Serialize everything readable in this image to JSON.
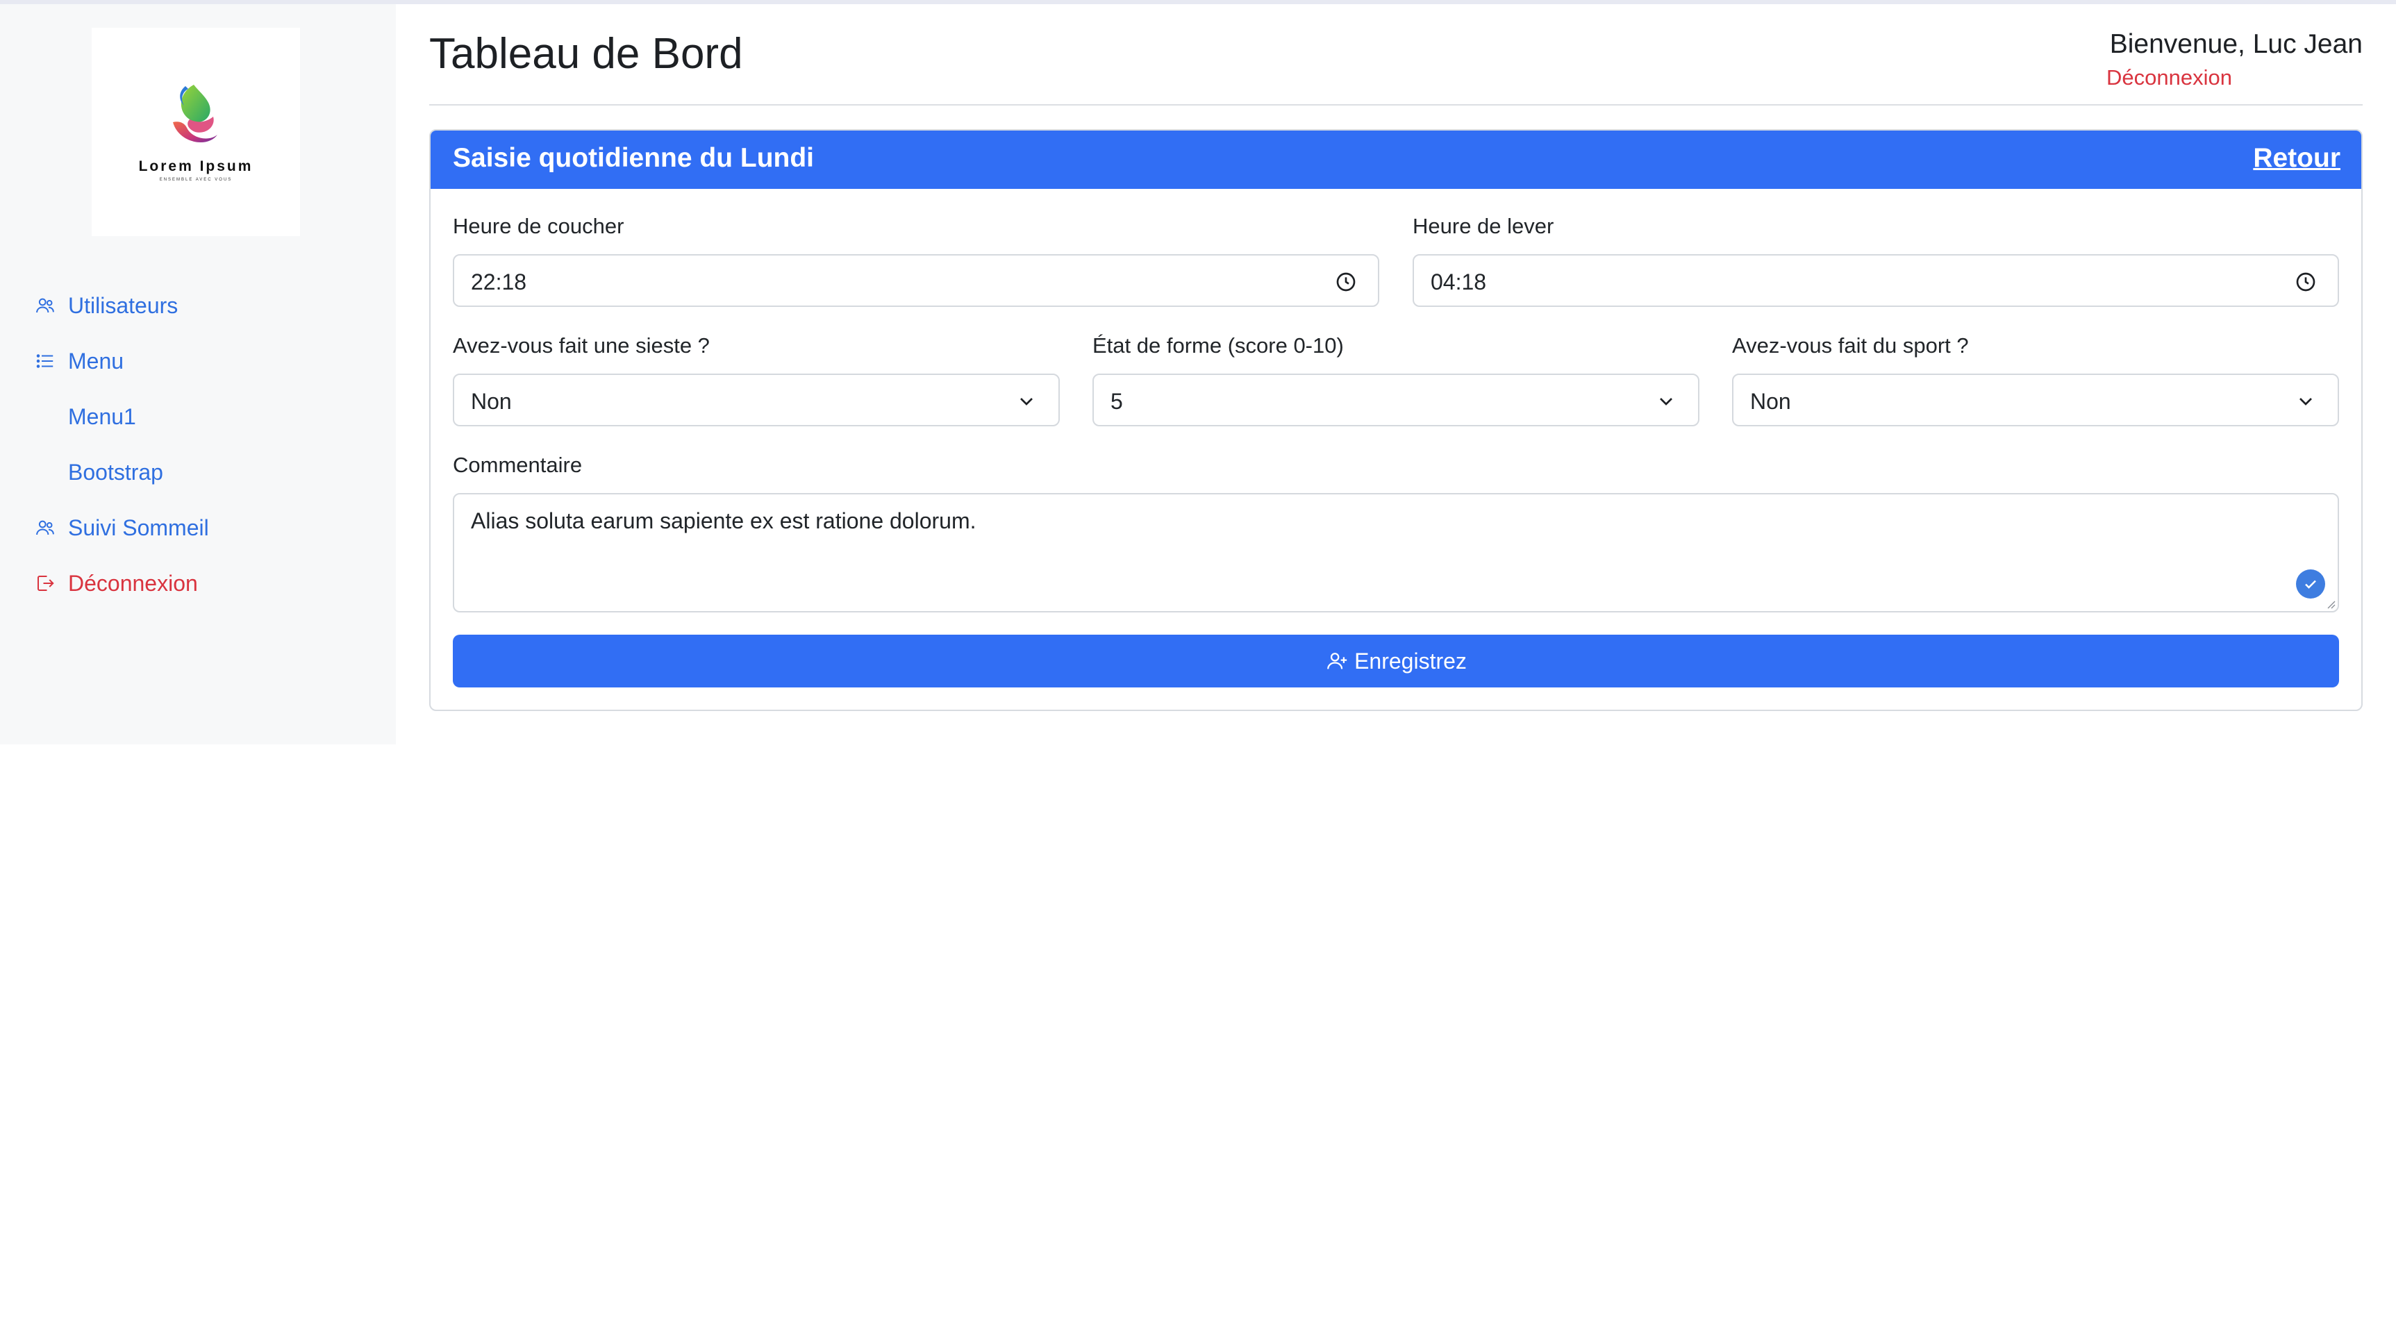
{
  "logo": {
    "name": "Lorem Ipsum",
    "tagline": "ENSEMBLE AVEC VOUS"
  },
  "sidebar": {
    "items": [
      {
        "label": "Utilisateurs",
        "icon": "users-icon"
      },
      {
        "label": "Menu",
        "icon": "list-icon"
      },
      {
        "label": "Menu1"
      },
      {
        "label": "Bootstrap"
      },
      {
        "label": "Suivi Sommeil",
        "icon": "users-icon"
      },
      {
        "label": "Déconnexion",
        "icon": "logout-icon"
      }
    ]
  },
  "header": {
    "title": "Tableau de Bord",
    "welcome": "Bienvenue, Luc Jean",
    "logout": "Déconnexion"
  },
  "card": {
    "title": "Saisie quotidienne du Lundi",
    "back": "Retour"
  },
  "form": {
    "bedtime": {
      "label": "Heure de coucher",
      "value": "22:18"
    },
    "waketime": {
      "label": "Heure de lever",
      "value": "04:18"
    },
    "nap": {
      "label": "Avez-vous fait une sieste ?",
      "value": "Non"
    },
    "fitness": {
      "label": "État de forme (score 0-10)",
      "value": "5"
    },
    "sport": {
      "label": "Avez-vous fait du sport ?",
      "value": "Non"
    },
    "comment": {
      "label": "Commentaire",
      "value": "Alias soluta earum sapiente ex est ratione dolorum."
    },
    "submit": "Enregistrez"
  },
  "colors": {
    "primary": "#316ef4",
    "link": "#2f6fe0",
    "danger": "#d9343f",
    "sidebar_bg": "#f7f8f9"
  }
}
